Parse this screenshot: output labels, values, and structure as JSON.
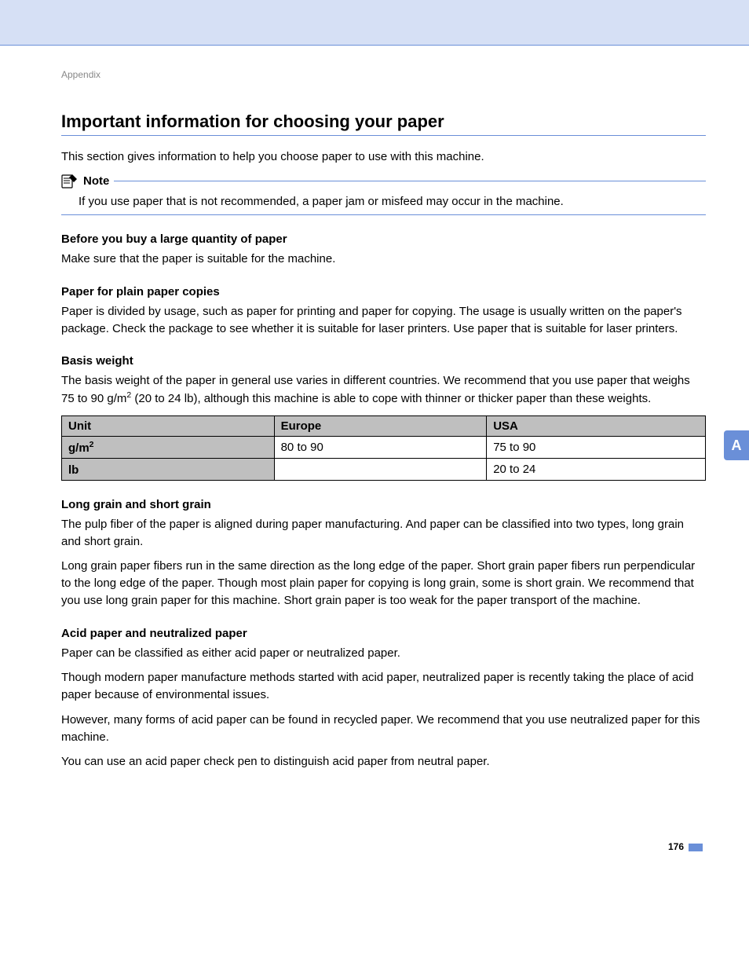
{
  "breadcrumb": "Appendix",
  "title": "Important information for choosing your paper",
  "intro": "This section gives information to help you choose paper to use with this machine.",
  "note": {
    "label": "Note",
    "body": "If you use paper that is not recommended, a paper jam or misfeed may occur in the machine."
  },
  "sections": {
    "s1": {
      "heading": "Before you buy a large quantity of paper",
      "p1": "Make sure that the paper is suitable for the machine."
    },
    "s2": {
      "heading": "Paper for plain paper copies",
      "p1": "Paper is divided by usage, such as paper for printing and paper for copying. The usage is usually written on the paper's package. Check the package to see whether it is suitable for laser printers. Use paper that is suitable for laser printers."
    },
    "s3": {
      "heading": "Basis weight",
      "p1_a": "The basis weight of the paper in general use varies in different countries. We recommend that you use paper that weighs 75 to 90 g/m",
      "p1_b": " (20 to 24 lb), although this machine is able to cope with thinner or thicker paper than these weights."
    },
    "s4": {
      "heading": "Long grain and short grain",
      "p1": "The pulp fiber of the paper is aligned during paper manufacturing. And paper can be classified into two types, long grain and short grain.",
      "p2": "Long grain paper fibers run in the same direction as the long edge of the paper. Short grain paper fibers run perpendicular to the long edge of the paper. Though most plain paper for copying is long grain, some is short grain. We recommend that you use long grain paper for this machine. Short grain paper is too weak for the paper transport of the machine."
    },
    "s5": {
      "heading": "Acid paper and neutralized paper",
      "p1": "Paper can be classified as either acid paper or neutralized paper.",
      "p2": "Though modern paper manufacture methods started with acid paper, neutralized paper is recently taking the place of acid paper because of environmental issues.",
      "p3": "However, many forms of acid paper can be found in recycled paper. We recommend that you use neutralized paper for this machine.",
      "p4": "You can use an acid paper check pen to distinguish acid paper from neutral paper."
    }
  },
  "table": {
    "headers": {
      "c1": "Unit",
      "c2": "Europe",
      "c3": "USA"
    },
    "rows": [
      {
        "c1_a": "g/m",
        "c1_sup": "2",
        "c2": "80 to 90",
        "c3": "75 to 90"
      },
      {
        "c1_a": "lb",
        "c1_sup": "",
        "c2": "",
        "c3": "20 to 24"
      }
    ]
  },
  "side_tab": "A",
  "page_number": "176",
  "chart_data": {
    "type": "table",
    "title": "Basis weight by region",
    "columns": [
      "Unit",
      "Europe",
      "USA"
    ],
    "rows": [
      [
        "g/m²",
        "80 to 90",
        "75 to 90"
      ],
      [
        "lb",
        "",
        "20 to 24"
      ]
    ]
  }
}
